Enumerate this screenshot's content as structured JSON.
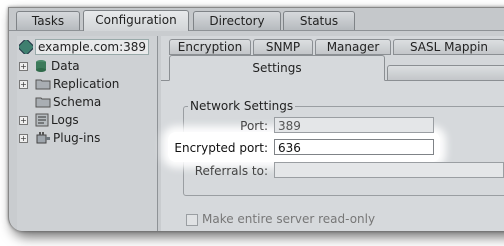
{
  "top_tabs": [
    "Tasks",
    "Configuration",
    "Directory",
    "Status"
  ],
  "active_top_tab": "Configuration",
  "tree": {
    "root": "example.com:389",
    "items": [
      {
        "label": "Data",
        "icon": "database-icon",
        "expandable": true
      },
      {
        "label": "Replication",
        "icon": "folder-icon",
        "expandable": true
      },
      {
        "label": "Schema",
        "icon": "folder-icon",
        "expandable": false
      },
      {
        "label": "Logs",
        "icon": "log-icon",
        "expandable": true
      },
      {
        "label": "Plug-ins",
        "icon": "plugin-icon",
        "expandable": true
      }
    ]
  },
  "sub_tabs_row1": [
    "Encryption",
    "SNMP",
    "Manager",
    "SASL Mappin"
  ],
  "sub_tabs_row2": [
    "Settings"
  ],
  "network_settings": {
    "title": "Network Settings",
    "port_label": "Port:",
    "port_value": "389",
    "encrypted_port_label": "Encrypted port:",
    "encrypted_port_value": "636",
    "referrals_label": "Referrals to:",
    "referrals_value": ""
  },
  "readonly_checkbox_label": "Make entire server read-only",
  "colors": {
    "window_bg": "#c9cccf",
    "panel_bg": "#d6d9dc",
    "highlight": "#ffffff"
  }
}
